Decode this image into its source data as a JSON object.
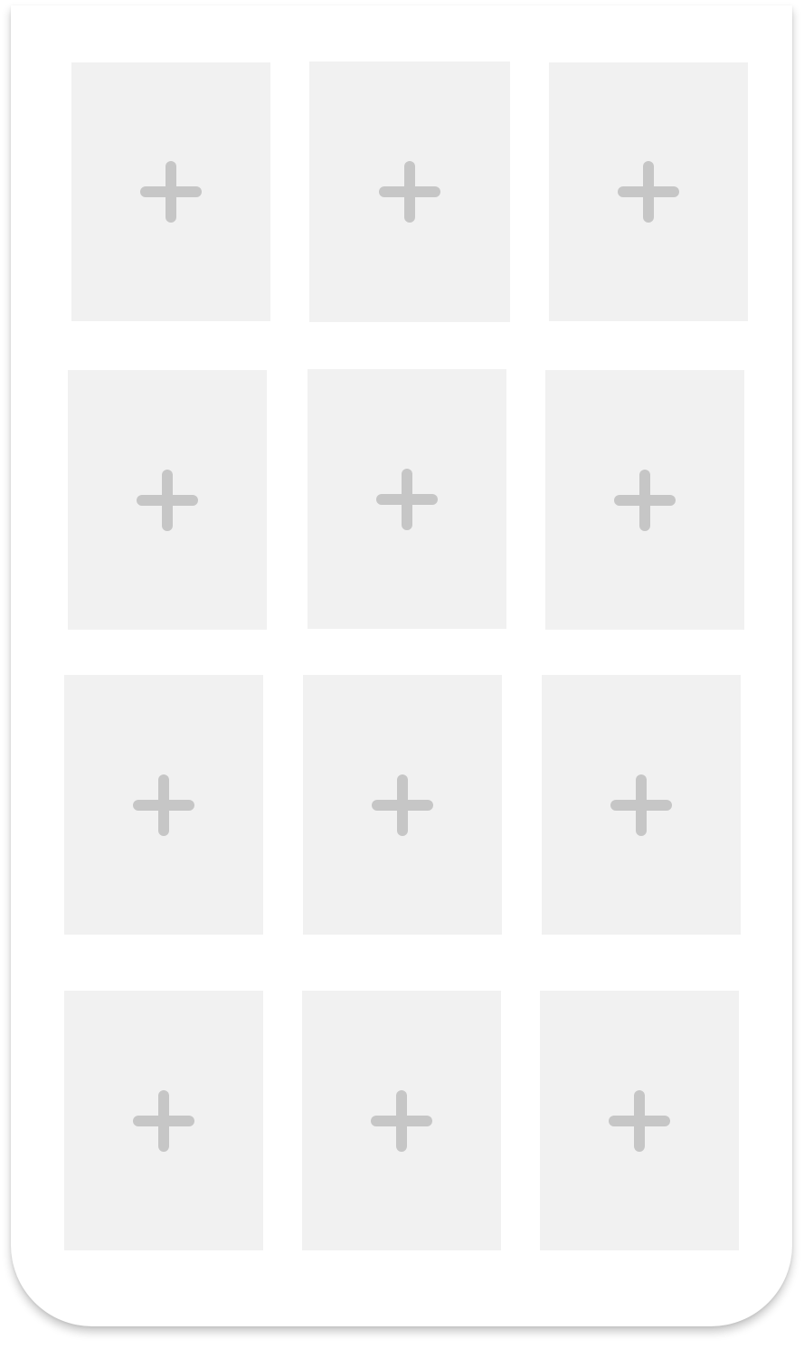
{
  "colors": {
    "card_background": "#ffffff",
    "slot_background": "#f1f1f1",
    "plus_icon": "#c6c6c6"
  },
  "grid": {
    "slots": [
      {
        "icon": "plus-icon"
      },
      {
        "icon": "plus-icon"
      },
      {
        "icon": "plus-icon"
      },
      {
        "icon": "plus-icon"
      },
      {
        "icon": "plus-icon"
      },
      {
        "icon": "plus-icon"
      },
      {
        "icon": "plus-icon"
      },
      {
        "icon": "plus-icon"
      },
      {
        "icon": "plus-icon"
      },
      {
        "icon": "plus-icon"
      },
      {
        "icon": "plus-icon"
      },
      {
        "icon": "plus-icon"
      }
    ]
  }
}
